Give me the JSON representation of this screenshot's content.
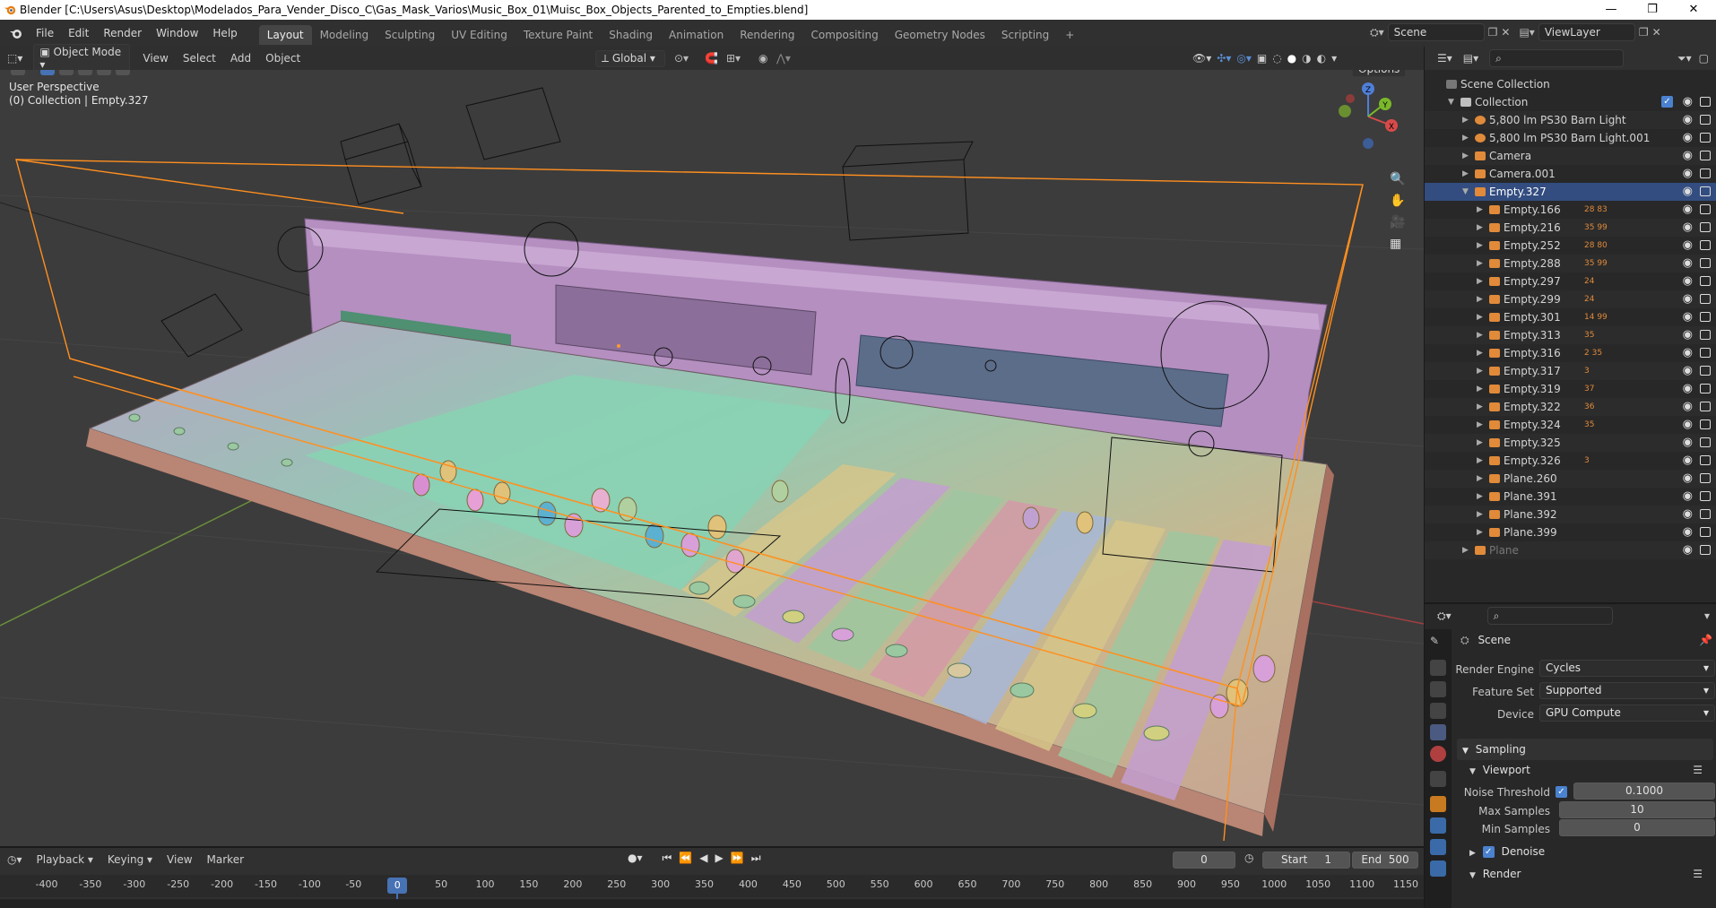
{
  "window": {
    "title": "Blender [C:\\Users\\Asus\\Desktop\\Modelados_Para_Vender_Disco_C\\Gas_Mask_Varios\\Music_Box_01\\Muisc_Box_Objects_Parented_to_Empties.blend]",
    "minimize": "—",
    "maximize": "❐",
    "close": "✕"
  },
  "menus": [
    "File",
    "Edit",
    "Render",
    "Window",
    "Help"
  ],
  "workspaces": [
    "Layout",
    "Modeling",
    "Sculpting",
    "UV Editing",
    "Texture Paint",
    "Shading",
    "Animation",
    "Rendering",
    "Compositing",
    "Geometry Nodes",
    "Scripting"
  ],
  "add_workspace": "+",
  "scene": {
    "name": "Scene",
    "view_layer": "ViewLayer"
  },
  "viewport_header": {
    "mode": "Object Mode",
    "menus": [
      "View",
      "Select",
      "Add",
      "Object"
    ],
    "orientation": "Global",
    "options": "Options"
  },
  "viewport": {
    "perspective": "User Perspective",
    "context": "(0) Collection | Empty.327",
    "gizmo": {
      "x": "X",
      "y": "Y",
      "z": "Z"
    }
  },
  "outliner": {
    "scene_collection": "Scene Collection",
    "rows": [
      {
        "label": "Collection",
        "indent": 1,
        "type": "collection",
        "open": true
      },
      {
        "label": "5,800 lm PS30 Barn Light",
        "indent": 2,
        "type": "light"
      },
      {
        "label": "5,800 lm PS30 Barn Light.001",
        "indent": 2,
        "type": "light"
      },
      {
        "label": "Camera",
        "indent": 2,
        "type": "camera"
      },
      {
        "label": "Camera.001",
        "indent": 2,
        "type": "camera"
      },
      {
        "label": "Empty.327",
        "indent": 2,
        "type": "empty",
        "open": true,
        "selected": true
      },
      {
        "label": "Empty.166",
        "indent": 3,
        "type": "empty",
        "badge": "28  83"
      },
      {
        "label": "Empty.216",
        "indent": 3,
        "type": "empty",
        "badge": "35  99"
      },
      {
        "label": "Empty.252",
        "indent": 3,
        "type": "empty",
        "badge": "28  80"
      },
      {
        "label": "Empty.288",
        "indent": 3,
        "type": "empty",
        "badge": "35  99"
      },
      {
        "label": "Empty.297",
        "indent": 3,
        "type": "empty",
        "badge": "24"
      },
      {
        "label": "Empty.299",
        "indent": 3,
        "type": "empty",
        "badge": "24"
      },
      {
        "label": "Empty.301",
        "indent": 3,
        "type": "empty",
        "badge": "14  99"
      },
      {
        "label": "Empty.313",
        "indent": 3,
        "type": "empty",
        "badge": "35"
      },
      {
        "label": "Empty.316",
        "indent": 3,
        "type": "empty",
        "badge": "2  35"
      },
      {
        "label": "Empty.317",
        "indent": 3,
        "type": "empty",
        "badge": "3"
      },
      {
        "label": "Empty.319",
        "indent": 3,
        "type": "empty",
        "badge": "37"
      },
      {
        "label": "Empty.322",
        "indent": 3,
        "type": "empty",
        "badge": "36"
      },
      {
        "label": "Empty.324",
        "indent": 3,
        "type": "empty",
        "badge": "35"
      },
      {
        "label": "Empty.325",
        "indent": 3,
        "type": "empty",
        "badge": ""
      },
      {
        "label": "Empty.326",
        "indent": 3,
        "type": "empty",
        "badge": "3"
      },
      {
        "label": "Plane.260",
        "indent": 3,
        "type": "mesh",
        "badge": ""
      },
      {
        "label": "Plane.391",
        "indent": 3,
        "type": "mesh",
        "badge": ""
      },
      {
        "label": "Plane.392",
        "indent": 3,
        "type": "mesh",
        "badge": ""
      },
      {
        "label": "Plane.399",
        "indent": 3,
        "type": "mesh",
        "badge": ""
      },
      {
        "label": "Plane",
        "indent": 2,
        "type": "mesh",
        "dim": true
      }
    ]
  },
  "properties": {
    "context": "Scene",
    "render_engine_label": "Render Engine",
    "render_engine": "Cycles",
    "feature_set_label": "Feature Set",
    "feature_set": "Supported",
    "device_label": "Device",
    "device": "GPU Compute",
    "sampling": "Sampling",
    "viewport_panel": "Viewport",
    "noise_threshold_label": "Noise Threshold",
    "noise_threshold": "0.1000",
    "max_samples_label": "Max Samples",
    "max_samples": "10",
    "min_samples_label": "Min Samples",
    "min_samples": "0",
    "denoise": "Denoise",
    "render_panel": "Render"
  },
  "timeline": {
    "menus": [
      "Playback",
      "Keying",
      "View",
      "Marker"
    ],
    "current_frame": "0",
    "start_label": "Start",
    "start": "1",
    "end_label": "End",
    "end": "500",
    "ticks": [
      "-400",
      "-350",
      "-300",
      "-250",
      "-200",
      "-150",
      "-100",
      "-50",
      "0",
      "50",
      "100",
      "150",
      "200",
      "250",
      "300",
      "350",
      "400",
      "450",
      "500",
      "550",
      "600",
      "650",
      "700",
      "750",
      "800",
      "850",
      "900",
      "950",
      "1000",
      "1050",
      "1100",
      "1150"
    ],
    "playhead": "0"
  },
  "colors": {
    "selection": "#334d80",
    "accent": "#4772b3",
    "bbox": "#ff8f1f"
  }
}
